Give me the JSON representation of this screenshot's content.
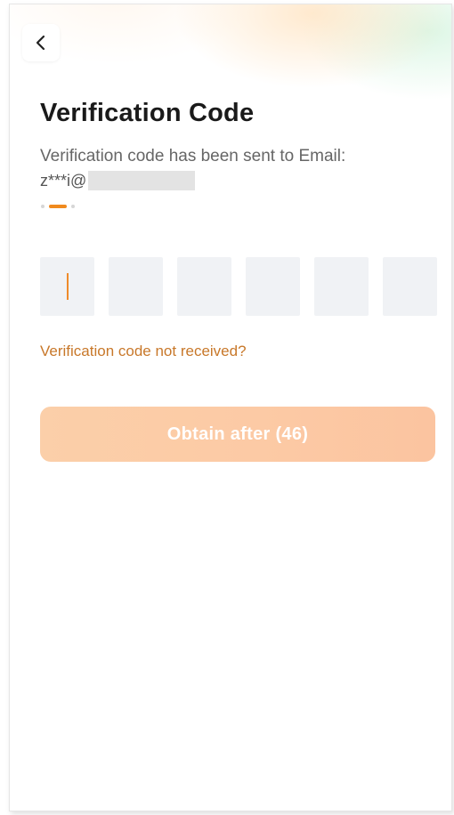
{
  "header": {
    "back_icon": "chevron-left-icon",
    "title": "Verification Code"
  },
  "message": {
    "sent_text": "Verification code has been sent to Email:",
    "email_prefix": "z***i@"
  },
  "code_input": {
    "length": 6,
    "values": [
      "",
      "",
      "",
      "",
      "",
      ""
    ],
    "active_index": 0
  },
  "links": {
    "not_received": "Verification code not received?"
  },
  "action": {
    "button_label": "Obtain after (46)"
  },
  "colors": {
    "accent": "#f08a1e",
    "link": "#c8782a",
    "button_bg": "#fccaa5",
    "input_bg": "#f0f2f5"
  }
}
